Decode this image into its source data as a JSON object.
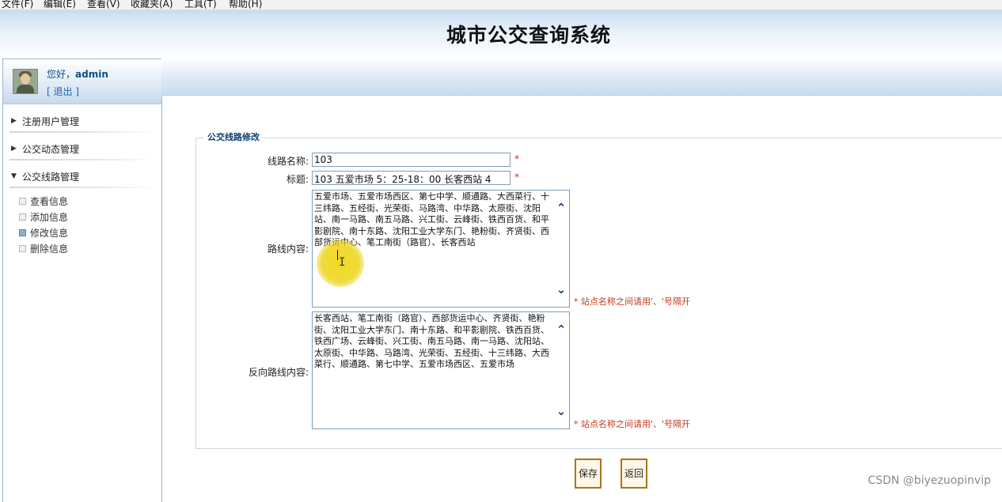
{
  "menu": [
    {
      "label": "文件(F)"
    },
    {
      "label": "编辑(E)"
    },
    {
      "label": "查看(V)"
    },
    {
      "label": "收藏夹(A)"
    },
    {
      "label": "工具(T)"
    },
    {
      "label": "帮助(H)"
    }
  ],
  "header": {
    "title": "城市公交查询系统"
  },
  "user": {
    "greeting": "您好，",
    "name": "admin",
    "logout": "[ 退出 ]"
  },
  "nav": {
    "groups": [
      {
        "label": "注册用户管理"
      },
      {
        "label": "公交动态管理"
      },
      {
        "label": "公交线路管理"
      }
    ],
    "sub": [
      {
        "label": "查看信息"
      },
      {
        "label": "添加信息"
      },
      {
        "label": "修改信息"
      },
      {
        "label": "删除信息"
      }
    ]
  },
  "form": {
    "legend": "公交线路修改",
    "name_label": "线路名称:",
    "name_value": "103",
    "title_label": "标题:",
    "title_value": "103 五爱市场  5：25-18：00    长客西站  4",
    "route_label": "路线内容:",
    "route_value": "五爱市场、五爱市场西区、第七中学、顺通路、大西菜行、十三纬路、五经街、光荣街、马路湾、中华路、太原街、沈阳站、南一马路、南五马路、兴工街、云峰街、铁西百货、和平影剧院、南十东路、沈阳工业大学东门、艳粉街、齐贤街、西部货运中心、笔工南街（路官）、长客西站",
    "reverse_label": "反向路线内容:",
    "reverse_value": "长客西站、笔工南街（路官）、西部货运中心、齐贤街、艳粉街、沈阳工业大学东门、南十东路、和平影剧院、铁西百货、铁西广场、云峰街、兴工街、南五马路、南一马路、沈阳站、太原街、中华路、马路湾、光荣街、五经街、十三纬路、大西菜行、顺通路、第七中学、五爱市场西区、五爱市场",
    "required_mark": "*",
    "note": "* 站点名称之间请用'、'号隔开",
    "save_label": "保存",
    "back_label": "返回"
  },
  "watermark": "CSDN @biyezuopinvip",
  "colors": {
    "accent": "#0b4f8a",
    "button_border": "#a57818",
    "note": "#c43a1c"
  }
}
